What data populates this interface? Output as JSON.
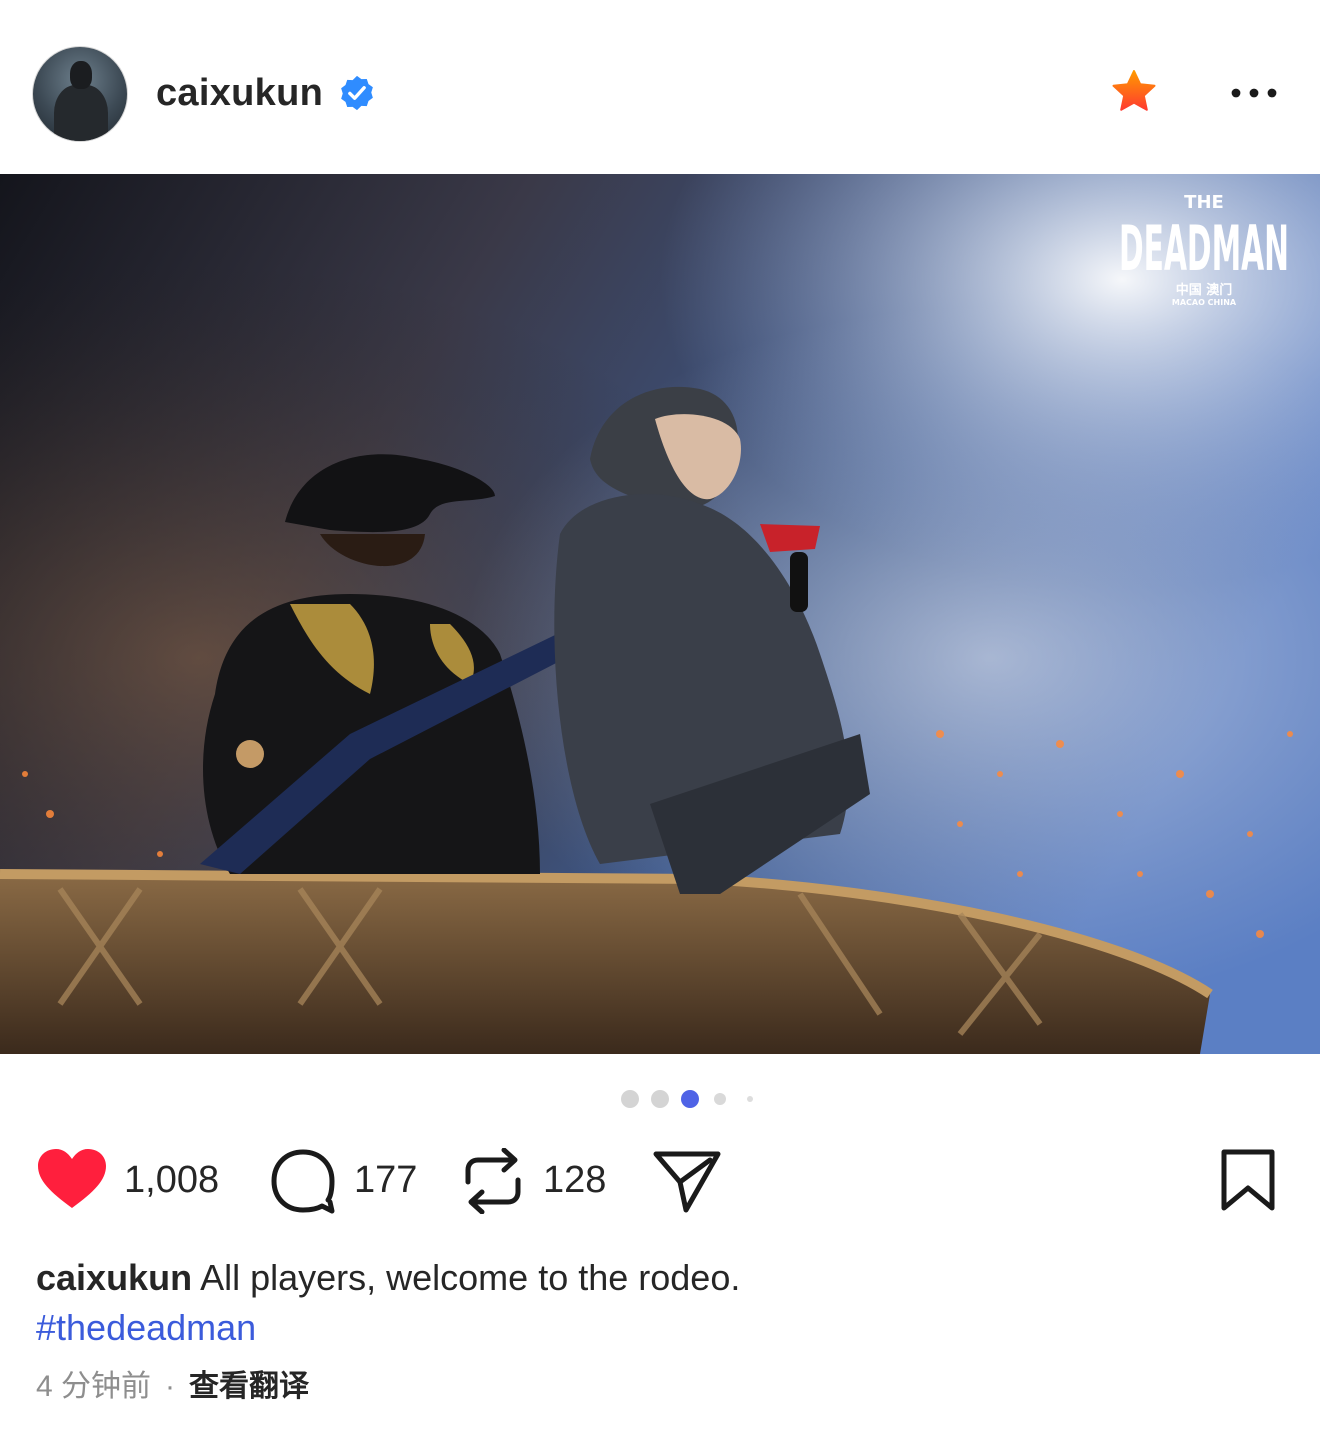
{
  "post": {
    "username": "caixukun",
    "verified": true,
    "image": {
      "watermark_title_small": "THE",
      "watermark_title_main": "DEADMAN",
      "watermark_location_cn": "中国 澳门",
      "watermark_location_en": "MACAO CHINA"
    },
    "carousel": {
      "total": 5,
      "active_index": 2
    },
    "actions": {
      "likes": "1,008",
      "comments": "177",
      "reposts": "128"
    },
    "caption": {
      "username": "caixukun",
      "text": " All players, welcome to the rodeo.",
      "hashtag": "#thedeadman"
    },
    "meta": {
      "time": "4 分钟前",
      "separator": "·",
      "translate": "查看翻译"
    }
  },
  "icons": {
    "verified": "verified-badge-icon",
    "favorite": "star-icon",
    "more": "more-options-icon",
    "like": "heart-icon",
    "comment": "comment-icon",
    "repost": "repost-icon",
    "share": "send-icon",
    "save": "bookmark-icon"
  },
  "colors": {
    "like": "#ff1f3d",
    "verified": "#2f8cff",
    "star_top": "#ff8a00",
    "star_bottom": "#ff3b2f",
    "hashtag": "#3b5bdb",
    "dot_active": "#4f63e6",
    "dot_inactive": "#d4d4d4"
  }
}
